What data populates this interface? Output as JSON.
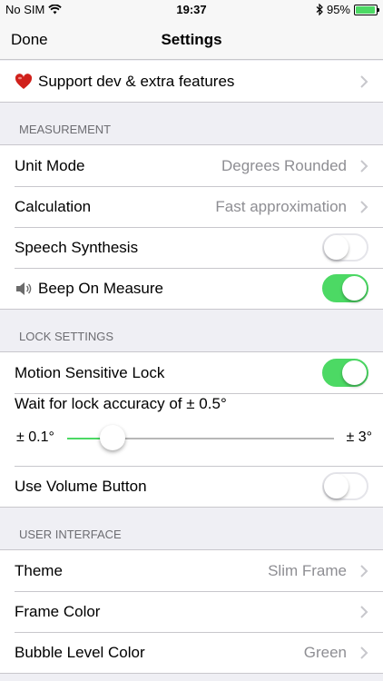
{
  "status": {
    "carrier": "No SIM",
    "time": "19:37",
    "battery": "95%",
    "battery_level": 0.95
  },
  "nav": {
    "done": "Done",
    "title": "Settings"
  },
  "support": {
    "label": "Support dev & extra features"
  },
  "sections": {
    "measurement": "MEASUREMENT",
    "lock": "LOCK SETTINGS",
    "ui": "USER INTERFACE"
  },
  "measurement": {
    "unit_mode": {
      "label": "Unit Mode",
      "value": "Degrees Rounded"
    },
    "calculation": {
      "label": "Calculation",
      "value": "Fast approximation"
    },
    "speech": {
      "label": "Speech Synthesis",
      "on": false
    },
    "beep": {
      "label": "Beep On Measure",
      "on": true
    }
  },
  "lock": {
    "motion": {
      "label": "Motion Sensitive Lock",
      "on": true
    },
    "accuracy": {
      "label": "Wait for lock accuracy of ± 0.5°",
      "min": "± 0.1°",
      "max": "± 3°",
      "level": 0.17
    },
    "volume": {
      "label": "Use Volume Button",
      "on": false
    }
  },
  "ui": {
    "theme": {
      "label": "Theme",
      "value": "Slim Frame"
    },
    "frame_color": {
      "label": "Frame Color"
    },
    "bubble_color": {
      "label": "Bubble Level Color",
      "value": "Green"
    }
  },
  "colors": {
    "switch_on": "#4cd964",
    "secondary_text": "#8e8e93",
    "background": "#efeff4"
  }
}
